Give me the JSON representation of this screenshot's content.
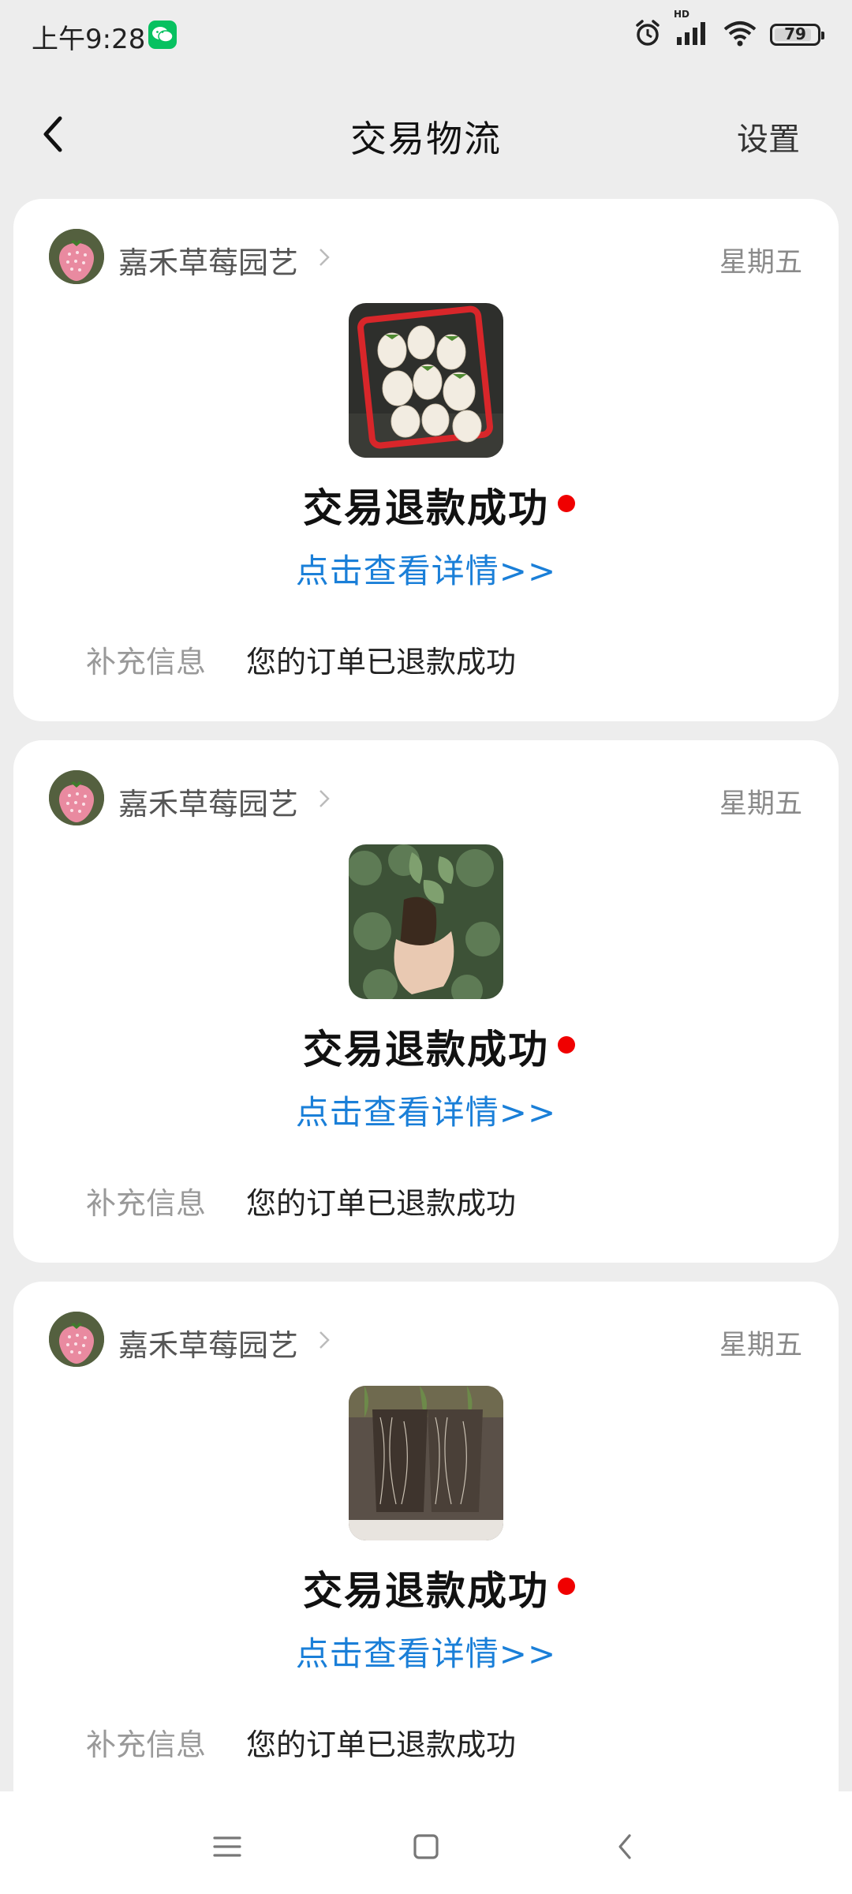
{
  "status_bar": {
    "time": "上午9:28",
    "notification_app_icon": "wechat-icon",
    "battery": "79",
    "hd_label": "HD",
    "icons": [
      "alarm-icon",
      "signal-icon",
      "wifi-icon",
      "battery-icon"
    ]
  },
  "header": {
    "title": "交易物流",
    "settings_label": "设置",
    "back_icon": "back-arrow-icon"
  },
  "colors": {
    "background": "#ededed",
    "card": "#ffffff",
    "link": "#1a7fd8",
    "dot": "#f00000"
  },
  "messages": [
    {
      "shop_name": "嘉禾草莓园艺",
      "date": "星期五",
      "title": "交易退款成功",
      "link_text": "点击查看详情>>",
      "extra_label": "补充信息",
      "extra_value": "您的订单已退款成功"
    },
    {
      "shop_name": "嘉禾草莓园艺",
      "date": "星期五",
      "title": "交易退款成功",
      "link_text": "点击查看详情>>",
      "extra_label": "补充信息",
      "extra_value": "您的订单已退款成功"
    },
    {
      "shop_name": "嘉禾草莓园艺",
      "date": "星期五",
      "title": "交易退款成功",
      "link_text": "点击查看详情>>",
      "extra_label": "补充信息",
      "extra_value": "您的订单已退款成功"
    }
  ],
  "bottom_nav": {
    "icons": [
      "menu-icon",
      "home-square-icon",
      "back-chevron-icon"
    ]
  }
}
